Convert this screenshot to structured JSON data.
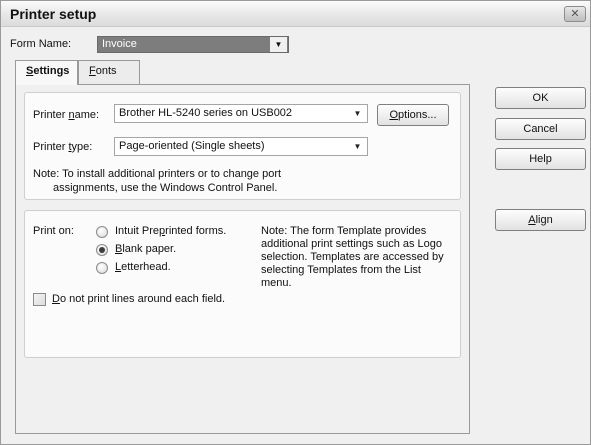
{
  "window": {
    "title": "Printer setup",
    "close_glyph": "✕"
  },
  "form_name": {
    "label": "Form Name:",
    "value": "Invoice"
  },
  "tabs": [
    {
      "label": "Settings",
      "mnemonic_index": 0,
      "active": true
    },
    {
      "label": "Fonts",
      "mnemonic_index": 0,
      "active": false
    }
  ],
  "printer": {
    "name_label_pre": "Printer ",
    "name_label_u": "n",
    "name_label_post": "ame:",
    "name_value": "Brother HL-5240 series on USB002",
    "options_pre": "",
    "options_u": "O",
    "options_post": "ptions...",
    "type_label_pre": "Printer ",
    "type_label_u": "t",
    "type_label_post": "ype:",
    "type_value": "Page-oriented (Single sheets)",
    "note_line1": "Note: To install additional printers or to change port",
    "note_line2": "assignments, use the Windows Control Panel."
  },
  "print_on": {
    "label": "Print on:",
    "options": [
      {
        "pre": "Intuit Pre",
        "u": "p",
        "post": "rinted forms.",
        "checked": false
      },
      {
        "pre": "",
        "u": "B",
        "post": "lank paper.",
        "checked": true
      },
      {
        "pre": "",
        "u": "L",
        "post": "etterhead.",
        "checked": false
      }
    ],
    "note_lines": [
      "Note: The form Template provides",
      "additional print settings such as Logo",
      "selection.  Templates are accessed by",
      "selecting Templates from the List",
      "menu."
    ],
    "checkbox_pre": "",
    "checkbox_u": "D",
    "checkbox_post": "o not print lines around each field.",
    "checkbox_checked": false
  },
  "buttons": {
    "ok": "OK",
    "cancel": "Cancel",
    "help": "Help",
    "align_u": "A",
    "align_post": "lign"
  },
  "icons": {
    "dropdown": "▼",
    "close": "close-icon"
  }
}
